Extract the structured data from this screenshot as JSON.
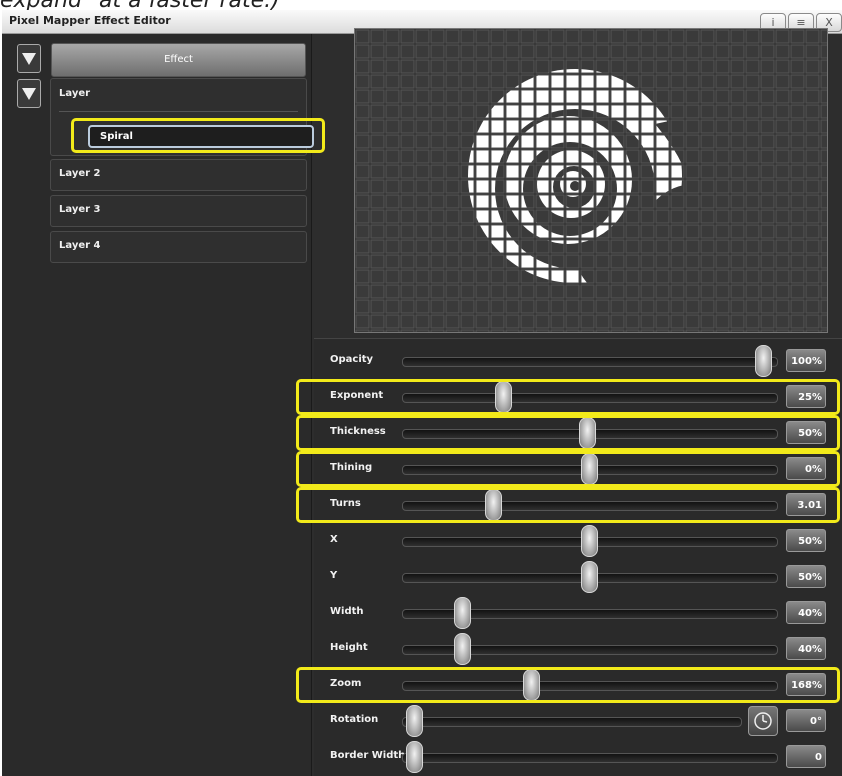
{
  "caption": "expand\" at a faster rate.)",
  "window": {
    "title": "Pixel Mapper Effect Editor",
    "buttons": [
      "i",
      "≡",
      "X"
    ]
  },
  "left_panel": {
    "effect_label": "Effect",
    "layer1_label": "Layer",
    "layer1_effect": "Spiral",
    "layers": [
      "Layer 2",
      "Layer 3",
      "Layer 4"
    ]
  },
  "properties": [
    {
      "label": "Opacity",
      "value": "100%",
      "level": 1.0
    },
    {
      "label": "Exponent",
      "value": "25%",
      "level": 0.25
    },
    {
      "label": "Thickness",
      "value": "50%",
      "level": 0.5
    },
    {
      "label": "Thining",
      "value": "0%",
      "level": 0.5
    },
    {
      "label": "Turns",
      "value": "3.01",
      "level": 0.24
    },
    {
      "label": "X",
      "value": "50%",
      "level": 0.5
    },
    {
      "label": "Y",
      "value": "50%",
      "level": 0.5
    },
    {
      "label": "Width",
      "value": "40%",
      "level": 0.16
    },
    {
      "label": "Height",
      "value": "40%",
      "level": 0.16
    },
    {
      "label": "Zoom",
      "value": "168%",
      "level": 0.35
    },
    {
      "label": "Rotation",
      "value": "0°",
      "level": 0.0
    },
    {
      "label": "Border Width",
      "value": "0",
      "level": 0.0
    }
  ],
  "highlighted": [
    "Spiral",
    "Exponent",
    "Thickness",
    "Thining",
    "Turns",
    "Zoom"
  ],
  "colors": {
    "highlight": "#f2ea1a",
    "panel": "#2a2a2a",
    "pixel_on": "#ffffff",
    "pixel_off": "#3a3a3a"
  },
  "icons": [
    "down-arrow-icon",
    "clock-icon",
    "info-icon",
    "menu-icon",
    "close-icon"
  ]
}
